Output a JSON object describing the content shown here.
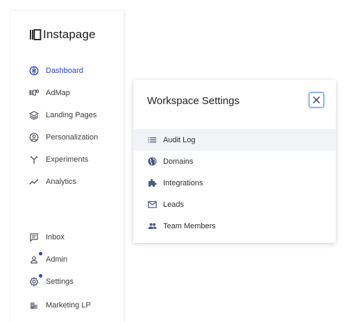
{
  "app": {
    "logo_text": "Instapage"
  },
  "colors": {
    "accent": "#2344c5",
    "icon": "#4a4f5c",
    "modal_icon": "#4a5a7a",
    "hover_row": "#f2f3f6",
    "close_border": "#5a8ef0"
  },
  "sidebar": {
    "items": [
      {
        "label": "Dashboard",
        "icon": "dashboard-icon",
        "active": true
      },
      {
        "label": "AdMap",
        "icon": "admap-icon"
      },
      {
        "label": "Landing Pages",
        "icon": "layers-icon"
      },
      {
        "label": "Personalization",
        "icon": "user-circle-icon"
      },
      {
        "label": "Experiments",
        "icon": "split-arrows-icon"
      },
      {
        "label": "Analytics",
        "icon": "trend-line-icon"
      }
    ],
    "bottom_items": [
      {
        "label": "Inbox",
        "icon": "inbox-icon"
      },
      {
        "label": "Admin",
        "icon": "admin-person-icon",
        "notification": true
      },
      {
        "label": "Settings",
        "icon": "gear-icon",
        "notification": true
      },
      {
        "label": "Marketing LP",
        "icon": "building-icon"
      }
    ]
  },
  "modal": {
    "title": "Workspace Settings",
    "close_icon": "close-icon",
    "items": [
      {
        "label": "Audit Log",
        "icon": "list-icon",
        "highlighted": true
      },
      {
        "label": "Domains",
        "icon": "globe-icon"
      },
      {
        "label": "Integrations",
        "icon": "puzzle-icon"
      },
      {
        "label": "Leads",
        "icon": "mail-icon"
      },
      {
        "label": "Team Members",
        "icon": "people-icon"
      }
    ]
  }
}
